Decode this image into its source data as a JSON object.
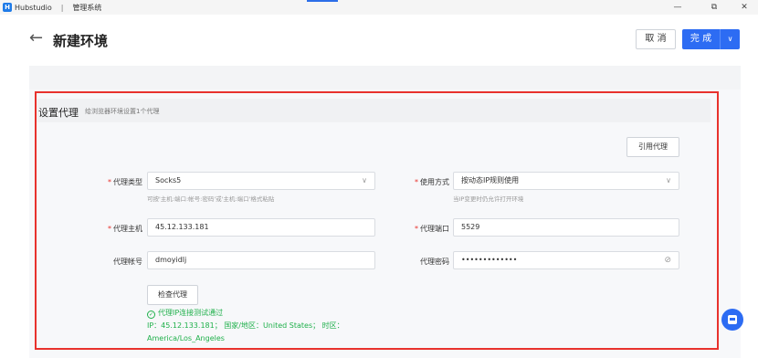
{
  "titlebar": {
    "app_name": "Hubstudio",
    "separator": "|",
    "section": "管理系统",
    "minimize": "—",
    "restore": "⧉",
    "close": "✕"
  },
  "header": {
    "title": "新建环境",
    "cancel_label": "取 消",
    "done_label": "完 成"
  },
  "section": {
    "title": "设置代理",
    "subtitle": "给浏览器环境设置1个代理"
  },
  "form": {
    "import_button": "引用代理",
    "proxy_type": {
      "label": "代理类型",
      "value": "Socks5",
      "hint": "可按'主机:端口:帐号:密码'或'主机:端口'格式粘贴"
    },
    "usage_mode": {
      "label": "使用方式",
      "value": "按动态IP规则使用",
      "hint": "当IP变更时仍允许打开环境"
    },
    "proxy_host": {
      "label": "代理主机",
      "value": "45.12.133.181"
    },
    "proxy_port": {
      "label": "代理端口",
      "value": "5529"
    },
    "proxy_account": {
      "label": "代理帐号",
      "value": "dmoyidlj"
    },
    "proxy_password": {
      "label": "代理密码",
      "value": "•••••••••••••"
    },
    "check_button": "检查代理",
    "status_text": "代理IP连接测试通过",
    "status_detail": "IP：45.12.133.181；  国家/地区：United States；  时区：America/Los_Angeles"
  },
  "colors": {
    "accent": "#2d6cf3",
    "highlight": "#e8322d",
    "success": "#1fb04b"
  },
  "icons": {
    "back": "arrow-left-icon",
    "dropdown": "chevron-down-icon",
    "eye": "eye-slash-icon",
    "check": "check-circle-icon",
    "fab": "save-icon"
  }
}
